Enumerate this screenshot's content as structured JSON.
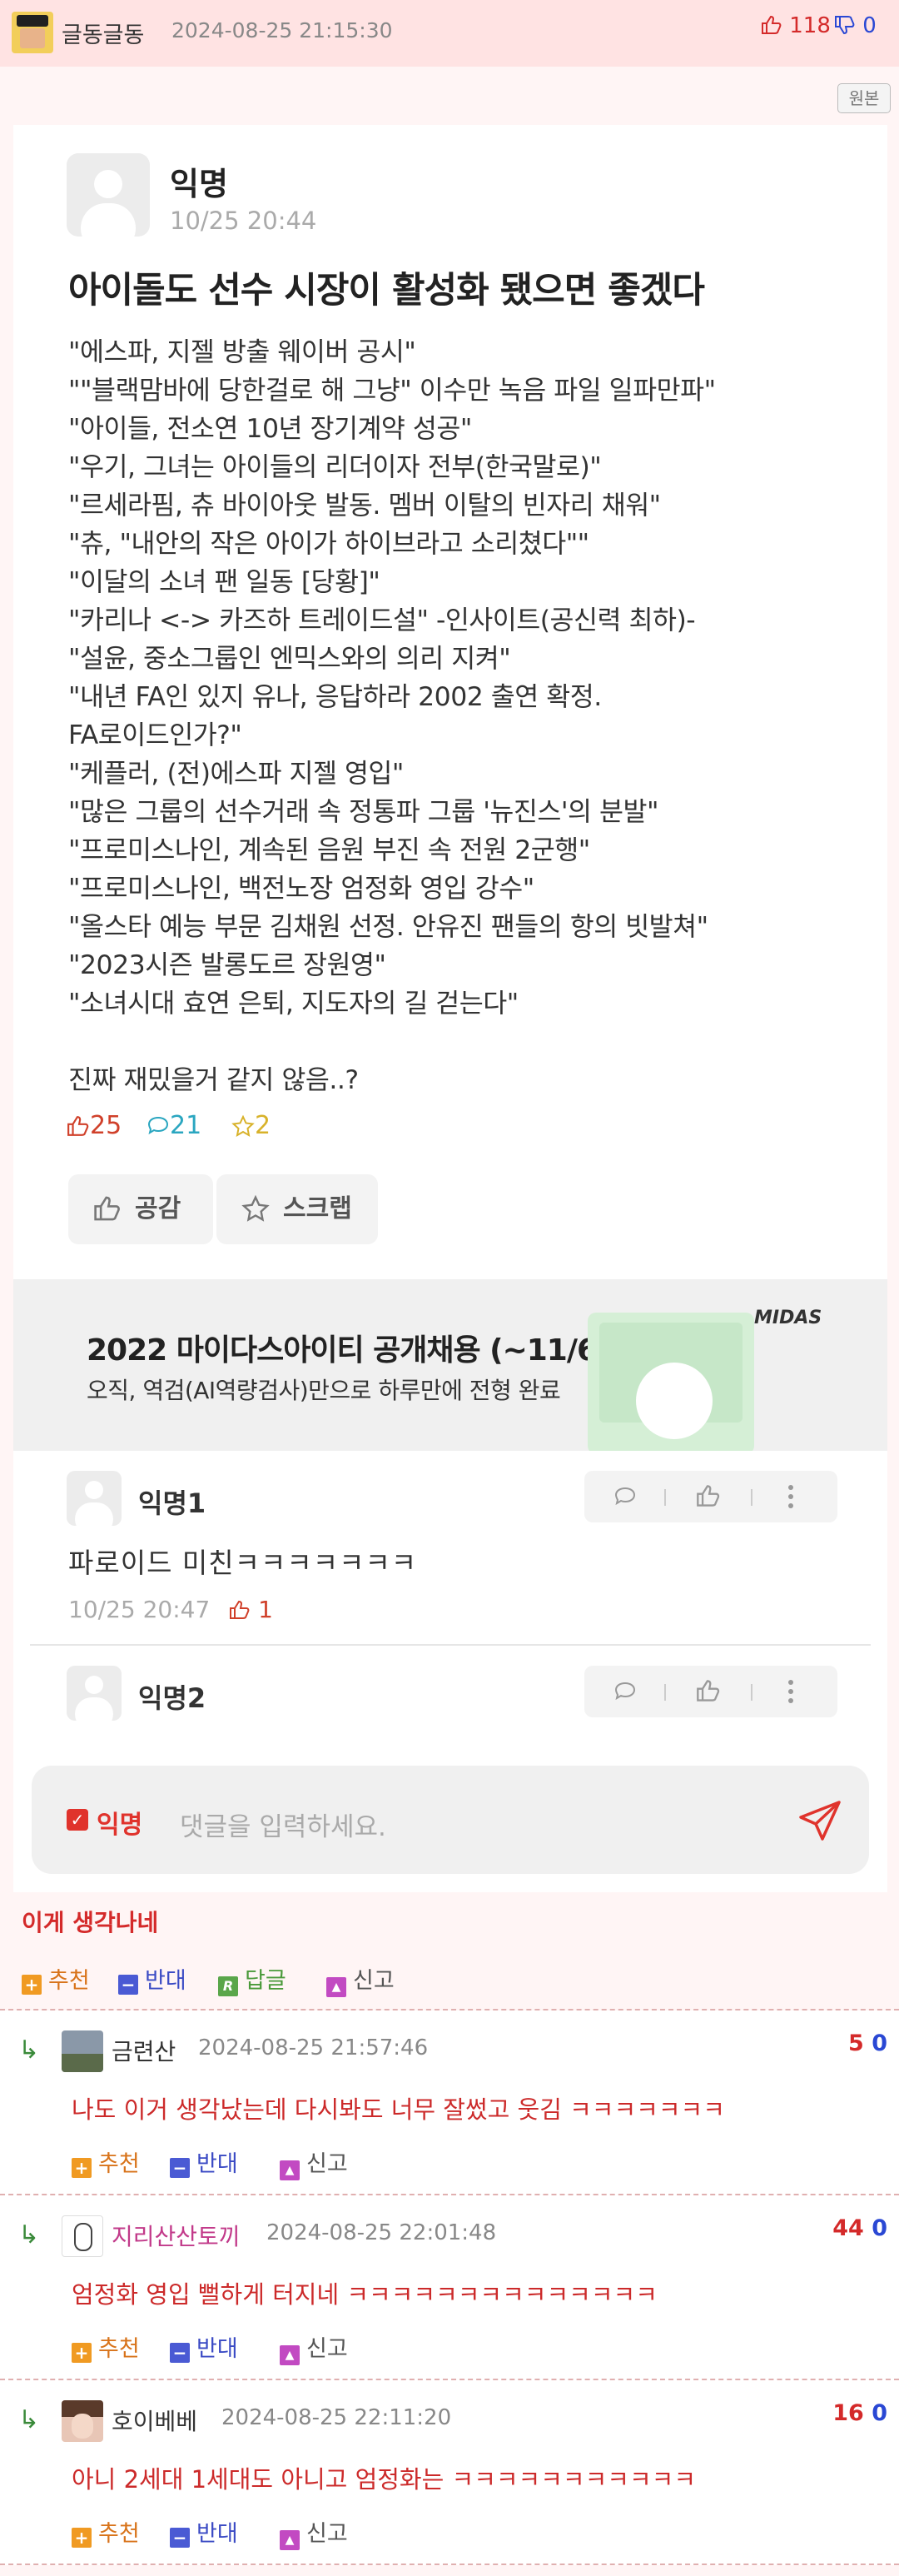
{
  "topbar": {
    "author": "글동글동",
    "datetime": "2024-08-25 21:15:30",
    "upvotes": "118",
    "downvotes": "0"
  },
  "original_button": "원본",
  "post": {
    "author": "익명",
    "date": "10/25 20:44",
    "title": "아이돌도 선수 시장이 활성화 됐으면 좋겠다",
    "body_lines": [
      "\"에스파, 지젤 방출 웨이버 공시\"",
      "\"\"블랙맘바에 당한걸로 해 그냥\" 이수만 녹음 파일 일파만파\"",
      "\"아이들, 전소연 10년 장기계약 성공\"",
      "\"우기, 그녀는 아이들의 리더이자 전부(한국말로)\"",
      "\"르세라핌, 츄 바이아웃 발동. 멤버 이탈의 빈자리 채워\"",
      "\"츄, \"내안의 작은 아이가 하이브라고 소리쳤다\"\"",
      "\"이달의 소녀 팬 일동 [당황]\"",
      "\"카리나 <-> 카즈하 트레이드설\" -인사이트(공신력 최하)-",
      "\"설윤, 중소그룹인 엔믹스와의 의리 지켜\"",
      "\"내년 FA인 있지 유나, 응답하라 2002 출연 확정.",
      "FA로이드인가?\"",
      "\"케플러, (전)에스파 지젤 영입\"",
      "\"많은 그룹의 선수거래 속 정통파 그룹 '뉴진스'의 분발\"",
      "\"프로미스나인, 계속된 음원 부진 속 전원 2군행\"",
      "\"프로미스나인, 백전노장 엄정화 영입 강수\"",
      "\"올스타 예능 부문 김채원 선정. 안유진 팬들의 항의 빗발쳐\"",
      "\"2023시즌 발롱도르 장원영\"",
      "\"소녀시대 효연 은퇴, 지도자의 길 걷는다\"",
      "",
      "진짜 재밌을거 같지 않음..?"
    ],
    "likes": "25",
    "comments": "21",
    "scraps": "2",
    "like_button": "공감",
    "scrap_button": "스크랩"
  },
  "ad": {
    "headline": "2022 마이다스아이티 공개채용 (~11/6)",
    "subline": "오직, 역검(AI역량검사)만으로 하루만에 전형 완료",
    "logo": "MIDAS"
  },
  "comments": [
    {
      "author": "익명1",
      "text": "파로이드 미친ㅋㅋㅋㅋㅋㅋㅋ",
      "date": "10/25 20:47",
      "likes": "1"
    },
    {
      "author": "익명2"
    }
  ],
  "input": {
    "anon_label": "익명",
    "placeholder": "댓글을 입력하세요."
  },
  "headline_comment": "이게 생각나네",
  "vote_labels": {
    "recommend": "추천",
    "oppose": "반대",
    "reply": "답글",
    "report": "신고"
  },
  "replies": [
    {
      "author": "금련산",
      "datetime": "2024-08-25 21:57:46",
      "up": "5",
      "down": "0",
      "text": "나도 이거 생각났는데 다시봐도 너무 잘썼고 웃김 ㅋㅋㅋㅋㅋㅋㅋ",
      "name_color": "#333333"
    },
    {
      "author": "지리산산토끼",
      "datetime": "2024-08-25 22:01:48",
      "up": "44",
      "down": "0",
      "text": "엄정화 영입 뻘하게 터지네 ㅋㅋㅋㅋㅋㅋㅋㅋㅋㅋㅋㅋㅋㅋ",
      "name_color": "#c23a8a"
    },
    {
      "author": "호이베베",
      "datetime": "2024-08-25 22:11:20",
      "up": "16",
      "down": "0",
      "text": "아니 2세대 1세대도 아니고 엄정화는 ㅋㅋㅋㅋㅋㅋㅋㅋㅋㅋㅋ",
      "name_color": "#333333"
    }
  ]
}
